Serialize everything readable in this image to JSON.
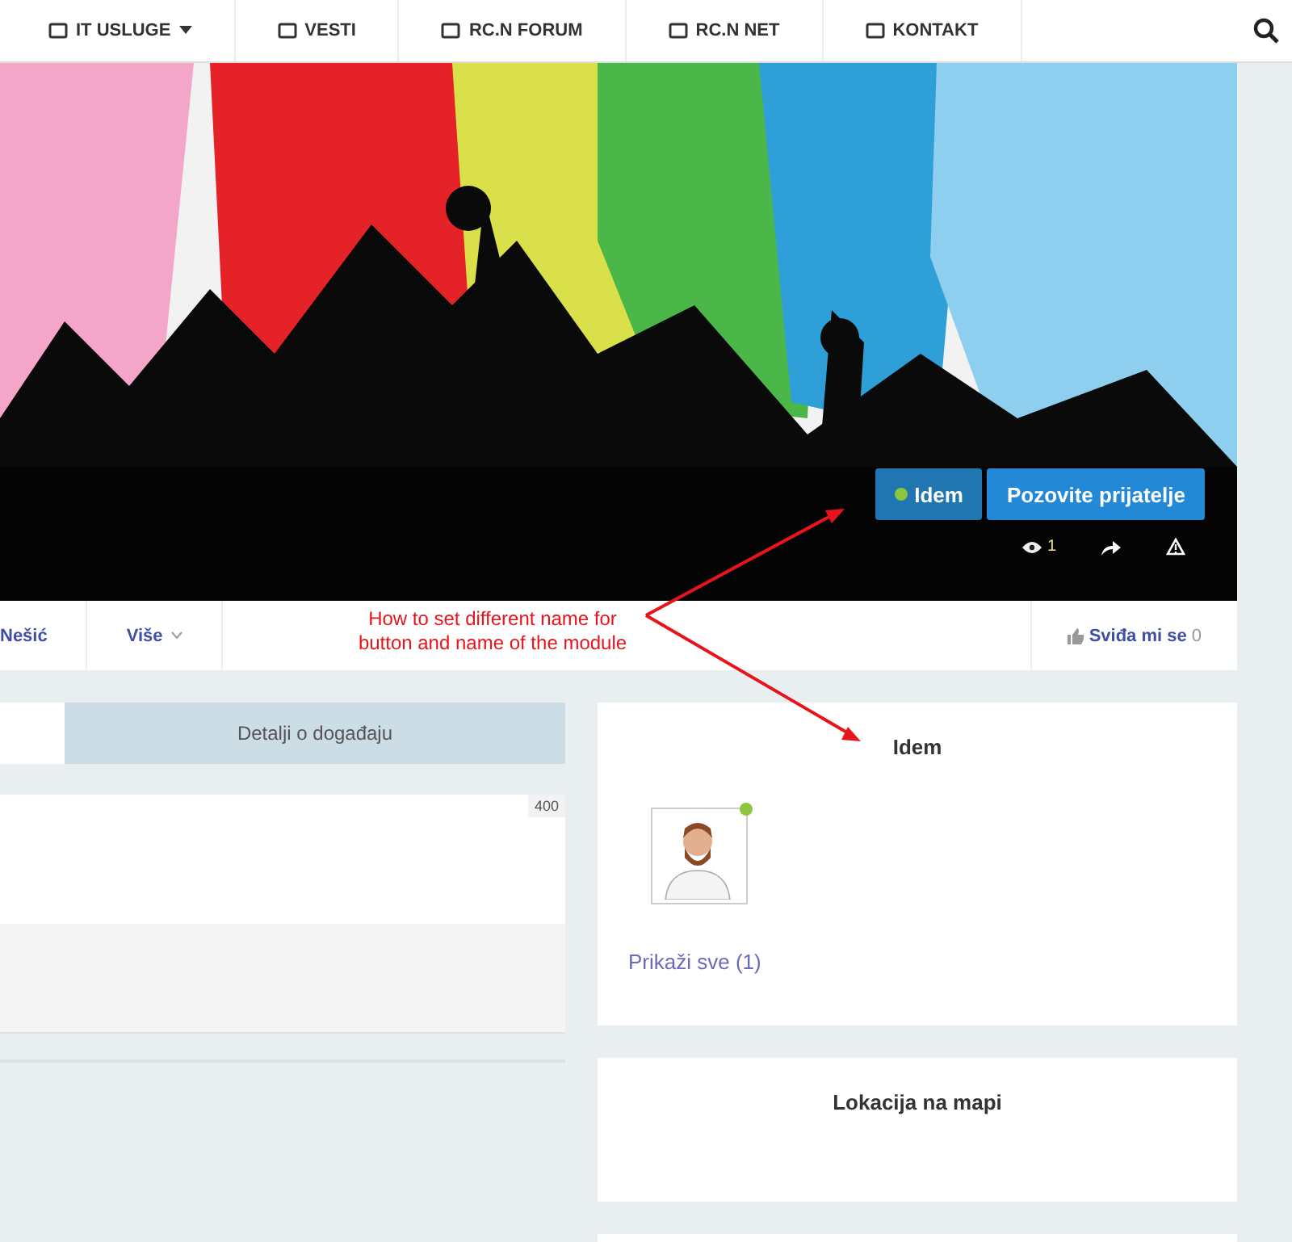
{
  "nav": {
    "items": [
      {
        "label": "IT USLUGE",
        "has_menu": true
      },
      {
        "label": "VESTI",
        "has_menu": false
      },
      {
        "label": "RC.N FORUM",
        "has_menu": false
      },
      {
        "label": "RC.N NET",
        "has_menu": false
      },
      {
        "label": "KONTAKT",
        "has_menu": false
      }
    ]
  },
  "hero": {
    "kind": "picture",
    "going_button": {
      "label": "Idem",
      "active": true
    },
    "invite_button": "Pozovite prijatelje",
    "views": "1"
  },
  "action_bar": {
    "items": [
      {
        "label": "Nešić",
        "has_menu": false
      },
      {
        "label": "Više",
        "has_menu": true
      }
    ],
    "like": {
      "label": "Sviđa mi se",
      "count": "0"
    }
  },
  "annotation": {
    "lines": [
      "How to set different name for",
      "button and name of the module"
    ]
  },
  "tabs": [
    {
      "label": "Detalji o događaju",
      "selected": false
    }
  ],
  "editor": {
    "counter": "400"
  },
  "going_card": {
    "title": "Idem",
    "attendees": [
      {
        "online": true
      }
    ],
    "show_all": "Prikaži sve (1)"
  },
  "map_card": {
    "title": "Lokacija na mapi"
  }
}
